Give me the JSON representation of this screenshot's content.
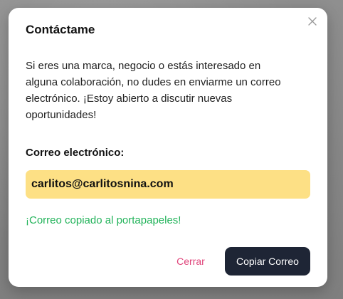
{
  "modal": {
    "title": "Contáctame",
    "description": "Si eres una marca, negocio o estás interesado en alguna colaboración, no dudes en enviarme un correo electrónico. ¡Estoy abierto a discutir nuevas oportunidades!",
    "email_label": "Correo electrónico:",
    "email_value": "carlitos@carlitosnina.com",
    "copied_message": "¡Correo copiado al portapapeles!",
    "cancel_label": "Cerrar",
    "copy_label": "Copiar Correo",
    "close_icon": "close-icon"
  },
  "colors": {
    "email_highlight": "#fde085",
    "success_text": "#22b35a",
    "cancel_text": "#e0457b",
    "primary_button": "#1e2535"
  }
}
